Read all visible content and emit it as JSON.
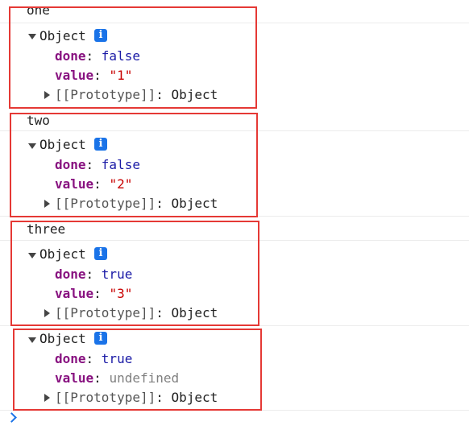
{
  "logs": [
    {
      "label": "one",
      "object_label": "Object",
      "info": "i",
      "done_key": "done",
      "done_value": "false",
      "value_key": "value",
      "value_value": "\"1\"",
      "prototype_label": "[[Prototype]]",
      "prototype_value": "Object"
    },
    {
      "label": "two",
      "object_label": "Object",
      "info": "i",
      "done_key": "done",
      "done_value": "false",
      "value_key": "value",
      "value_value": "\"2\"",
      "prototype_label": "[[Prototype]]",
      "prototype_value": "Object"
    },
    {
      "label": "three",
      "object_label": "Object",
      "info": "i",
      "done_key": "done",
      "done_value": "true",
      "value_key": "value",
      "value_value": "\"3\"",
      "prototype_label": "[[Prototype]]",
      "prototype_value": "Object"
    },
    {
      "object_label": "Object",
      "info": "i",
      "done_key": "done",
      "done_value": "true",
      "value_key": "value",
      "value_value": "undefined",
      "prototype_label": "[[Prototype]]",
      "prototype_value": "Object"
    }
  ],
  "colors": {
    "highlight_box": "#e53935",
    "key": "#881280",
    "boolean": "#1a1aa6",
    "string": "#c80000",
    "undefined": "#808080",
    "info_badge": "#1a73e8",
    "prompt": "#1a73e8"
  },
  "icons": {
    "expand": "triangle-down-icon",
    "collapse": "triangle-right-icon",
    "info": "info-icon",
    "prompt": "chevron-right-icon"
  }
}
